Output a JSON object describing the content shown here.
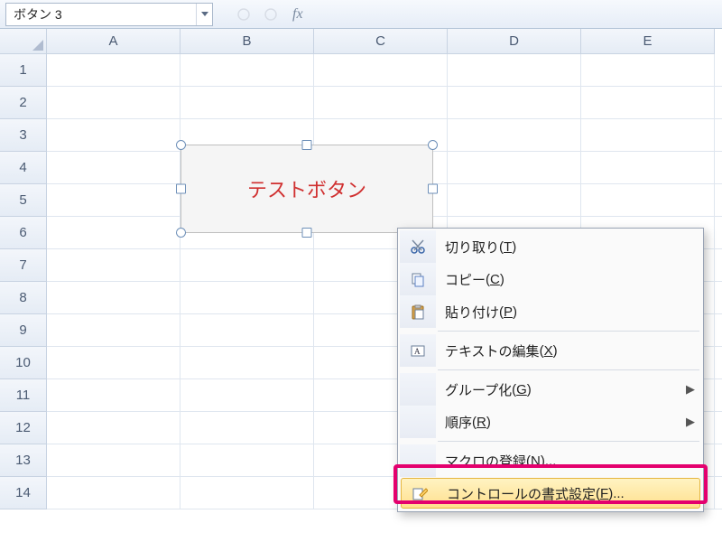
{
  "name_box": "ボタン 3",
  "fx_label": "fx",
  "columns": [
    "A",
    "B",
    "C",
    "D",
    "E"
  ],
  "rows": [
    "1",
    "2",
    "3",
    "4",
    "5",
    "6",
    "7",
    "8",
    "9",
    "10",
    "11",
    "12",
    "13",
    "14"
  ],
  "button": {
    "text": "テストボタン"
  },
  "menu": {
    "cut": {
      "label": "切り取り",
      "key": "T"
    },
    "copy": {
      "label": "コピー",
      "key": "C"
    },
    "paste": {
      "label": "貼り付け",
      "key": "P"
    },
    "edit_text": {
      "label": "テキストの編集",
      "key": "X"
    },
    "group": {
      "label": "グループ化",
      "key": "G"
    },
    "order": {
      "label": "順序",
      "key": "R"
    },
    "assign": {
      "label": "マクロの登録",
      "key": "N",
      "tail": "..."
    },
    "format": {
      "label": "コントロールの書式設定",
      "key": "F",
      "tail": "..."
    }
  }
}
